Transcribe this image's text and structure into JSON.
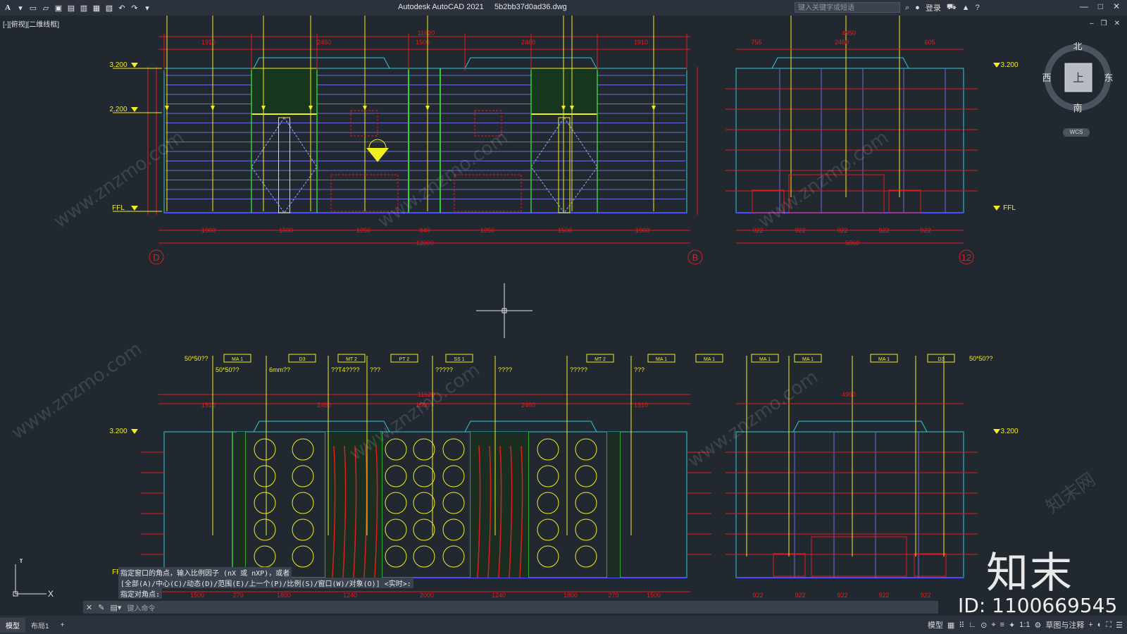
{
  "app": {
    "title": "Autodesk AutoCAD 2021",
    "file": "5b2bb37d0ad36.dwg",
    "logo": "A"
  },
  "search": {
    "placeholder": "键入关键字或短语"
  },
  "user": {
    "login": "登录"
  },
  "view_label": "[-][俯视][二维线框]",
  "compass": {
    "north": "北",
    "south": "南",
    "east": "东",
    "west": "西",
    "top": "上",
    "wcs": "WCS"
  },
  "command": {
    "history": [
      "指定窗口的角点，输入比例因子 (nX 或 nXP)，或者",
      "[全部(A)/中心(C)/动态(D)/范围(E)/上一个(P)/比例(S)/窗口(W)/对象(O)] <实时>:",
      "指定对角点:"
    ],
    "input_placeholder": "键入命令"
  },
  "status": {
    "tabs": [
      "模型",
      "布局1"
    ],
    "add": "+",
    "model_btn": "模型",
    "scale": "1:1",
    "workspace": "草图与注释"
  },
  "watermark": {
    "text": "www.znzmo.com",
    "cn": "知末网",
    "brand": "知末",
    "id": "ID: 1100669545"
  },
  "drawing": {
    "top_dims": [
      "1910",
      "2460",
      "1500",
      "2460",
      "1910",
      "11620",
      "4950",
      "755",
      "2460",
      "605"
    ],
    "levels": [
      "3.200",
      "2.200",
      "FFL"
    ],
    "bottom_dims": [
      "1960",
      "1500",
      "1950",
      "840",
      "1950",
      "1500",
      "1960",
      "12000",
      "922",
      "5060"
    ],
    "grid_labels": [
      "D",
      "B",
      "12"
    ],
    "lower_bottom_dims": [
      "1500",
      "270",
      "1800",
      "1240",
      "2000",
      "1240",
      "1800",
      "270",
      "1500",
      "922"
    ],
    "callouts": [
      "50*50??",
      "6mm??",
      "???",
      "??T4????",
      "??",
      "????",
      "?????",
      "50*50??"
    ],
    "tags": [
      "MA 1",
      "D3",
      "MT 2",
      "PT 2",
      "SS 1",
      "MA 1",
      "MT 2",
      "MA 1",
      "MA 1",
      "MA 1",
      "MA 1",
      "D3"
    ]
  },
  "colors": {
    "bg": "#212830",
    "dim": "#e21d1d",
    "cyan": "#33c7d8",
    "yellow": "#f2ee1f",
    "green": "#2fd12f",
    "blue": "#4b4bff"
  }
}
